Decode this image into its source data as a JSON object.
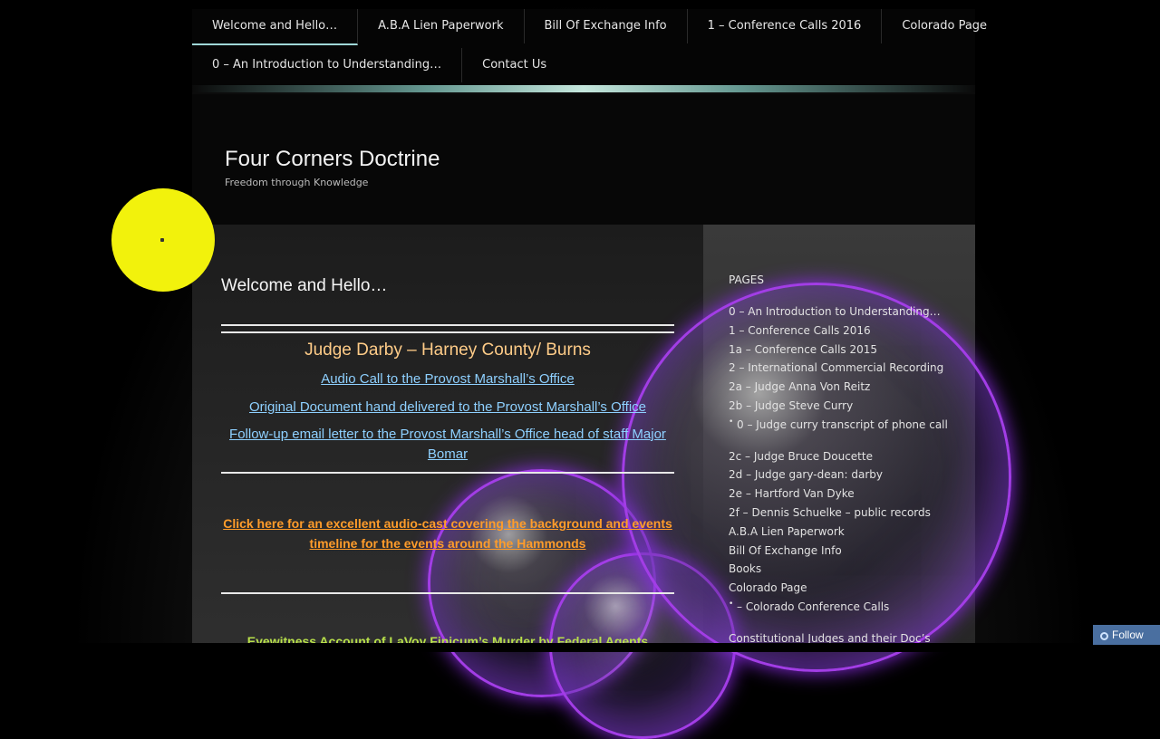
{
  "nav": {
    "row1": [
      {
        "label": "Welcome and Hello…",
        "active": true
      },
      {
        "label": "A.B.A Lien Paperwork"
      },
      {
        "label": "Bill Of Exchange Info"
      },
      {
        "label": "1 – Conference Calls 2016"
      },
      {
        "label": "Colorado Page"
      }
    ],
    "row2": [
      {
        "label": "0 – An Introduction to Understanding…"
      },
      {
        "label": "Contact Us"
      }
    ]
  },
  "header": {
    "title": "Four Corners Doctrine",
    "tagline": "Freedom through Knowledge"
  },
  "post": {
    "title": "Welcome and Hello…",
    "judge_heading": "Judge Darby – Harney County/ Burns",
    "links": [
      "Audio Call to the Provost Marshall’s Office",
      "Original Document hand delivered to the Provost Marshall’s Office",
      "Follow-up email letter to the Provost Marshall’s Office head of staff Major Bomar"
    ],
    "audio_cast_link": "Click here for an excellent audio-cast covering the background and events timeline for the events around the Hammonds",
    "eyewitness_link": "Eyewitness Account of LaVoy Finicum’s Murder by Federal Agents"
  },
  "sidebar": {
    "widget_title": "PAGES",
    "pages": [
      {
        "label": "0 – An Introduction to Understanding…"
      },
      {
        "label": "1 – Conference Calls 2016"
      },
      {
        "label": "1a – Conference Calls 2015"
      },
      {
        "label": "2 – International Commercial Recording"
      },
      {
        "label": "2a – Judge Anna Von Reitz"
      },
      {
        "label": "2b – Judge Steve Curry"
      },
      {
        "label": "0 – Judge curry transcript of phone call",
        "sub": true,
        "gap": true
      },
      {
        "label": "2c – Judge Bruce Doucette"
      },
      {
        "label": "2d – Judge gary-dean: darby"
      },
      {
        "label": "2e – Hartford Van Dyke"
      },
      {
        "label": "2f – Dennis Schuelke – public records"
      },
      {
        "label": "A.B.A Lien Paperwork"
      },
      {
        "label": "Bill Of Exchange Info"
      },
      {
        "label": "Books"
      },
      {
        "label": "Colorado Page"
      },
      {
        "label": "– Colorado Conference Calls",
        "sub": true,
        "gap": true
      },
      {
        "label": "Constitutional Judges and their Doc’s"
      }
    ]
  },
  "follow_button": "Follow",
  "colors": {
    "link_blue": "#8ed0ff",
    "link_orange": "#ff9c2a",
    "heading_orange": "#ffcc88",
    "link_green": "#b8e04a",
    "bubble_purple": "#a23de6",
    "cursor_highlight": "#f2f20c"
  }
}
